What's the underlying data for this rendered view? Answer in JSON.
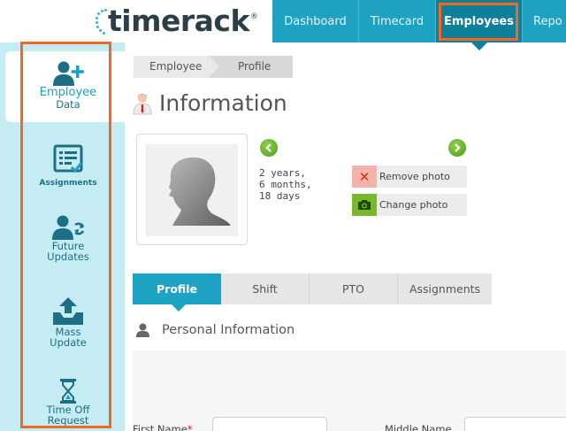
{
  "app": {
    "logo_text": "timerack",
    "logo_mark": "®",
    "brand_color": "#1ea2c1",
    "accent_color": "#f26a21"
  },
  "topnav": {
    "items": [
      {
        "label": "Dashboard"
      },
      {
        "label": "Timecard"
      },
      {
        "label": "Employees",
        "active": true
      },
      {
        "label": "Repo"
      }
    ]
  },
  "sidebar": {
    "items": [
      {
        "line1": "Employee",
        "line2": "Data",
        "icon": "user-plus-icon",
        "active": true
      },
      {
        "label": "Assignments",
        "icon": "checklist-icon"
      },
      {
        "line1": "Future",
        "line2": "Updates",
        "icon": "user-sync-icon"
      },
      {
        "line1": "Mass",
        "line2": "Update",
        "icon": "upload-tray-icon"
      },
      {
        "line1": "Time Off",
        "line2": "Request",
        "icon": "hourglass-icon"
      }
    ]
  },
  "breadcrumb": [
    "Employee",
    "Profile"
  ],
  "page": {
    "title": "Information",
    "title_icon": "employee-icon"
  },
  "profile": {
    "photo_icon": "silhouette-icon",
    "prev_icon": "chevron-left-icon",
    "next_icon": "chevron-right-icon",
    "tenure_years": "2 years,",
    "tenure_months": "6 months,",
    "tenure_days": "18 days",
    "remove_photo_label": "Remove photo",
    "change_photo_label": "Change photo"
  },
  "tabs": [
    {
      "label": "Profile",
      "active": true
    },
    {
      "label": "Shift"
    },
    {
      "label": "PTO"
    },
    {
      "label": "Assignments"
    }
  ],
  "section": {
    "title": "Personal Information",
    "icon": "person-icon"
  },
  "form": {
    "first_name_label": "First Name",
    "required_mark": "*",
    "middle_name_label": "Middle Name",
    "first_name_value": "",
    "middle_name_value": ""
  }
}
